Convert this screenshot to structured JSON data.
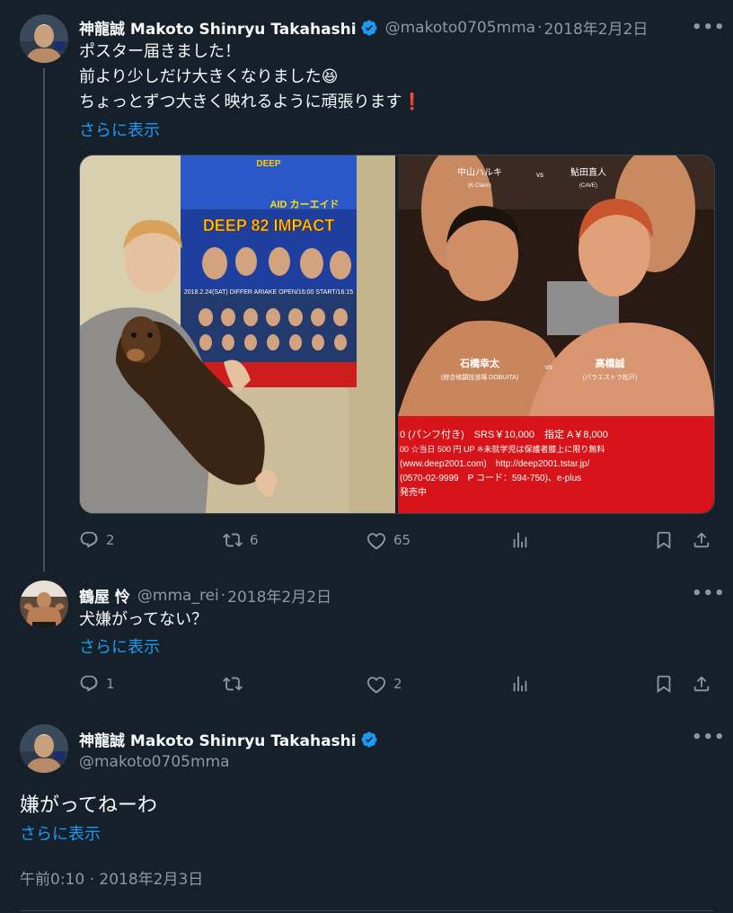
{
  "tweets": [
    {
      "name": "神龍誠 Makoto Shinryu Takahashi",
      "handle": "@makoto0705mma",
      "dot": "·",
      "date": "2018年2月2日",
      "text": "ポスター届きました！\n前より少しだけ大きくなりました😆\nちょっとずつ大きく映れるように頑張ります❗️",
      "show_more": "さらに表示",
      "more": "•••",
      "stats": {
        "replies": "2",
        "retweets": "6",
        "likes": "65"
      },
      "media": {
        "poster_top": "DEEP",
        "poster_sub": "AID カーエイド",
        "poster_title": "DEEP 82 IMPACT",
        "poster_date": "2018.2.24(SAT) DIFFER ARIAKE OPEN/16:00 START/16:15",
        "fighter_top_left": "中山ハルキ",
        "fighter_top_right": "鮎田直人",
        "fighter_top_left_gym": "(K-Clann)",
        "fighter_top_right_gym": "(CAVE)",
        "vs": "vs",
        "fighter_left": "石橋幸太",
        "fighter_left_gym": "(総合格闘技道場 DOBUITA)",
        "fighter_right": "高橋誠",
        "fighter_right_gym": "(パラエストラ松戸)",
        "price_line": "0 (パンフ付き)　SRS￥10,000　指定 A￥8,000",
        "note_line": "00 ☆当日 500 円 UP ※未就学児は保護者膝上に限り無料",
        "url_line": "(www.deep2001.com)　http://deep2001.tstar.jp/",
        "tel_line": "(0570-02-9999　P コード：594-750)、e-plus",
        "sale_line": "発売中"
      }
    },
    {
      "name": "鶴屋 怜",
      "handle": "@mma_rei",
      "dot": "·",
      "date": "2018年2月2日",
      "text": "犬嫌がってない？",
      "show_more": "さらに表示",
      "more": "•••",
      "stats": {
        "replies": "1",
        "retweets": "",
        "likes": "2"
      }
    },
    {
      "name": "神龍誠 Makoto Shinryu Takahashi",
      "handle": "@makoto0705mma",
      "text": "嫌がってねーわ",
      "show_more": "さらに表示",
      "more": "•••",
      "timestamp": "午前0:10 · 2018年2月3日"
    }
  ],
  "colors": {
    "background": "#15202b",
    "accent": "#1d9bf0",
    "muted": "#8b98a5",
    "poster_red": "#d7141a"
  },
  "icons": [
    "reply-icon",
    "retweet-icon",
    "like-icon",
    "views-icon",
    "bookmark-icon",
    "share-icon",
    "verified-badge-icon",
    "more-icon"
  ]
}
